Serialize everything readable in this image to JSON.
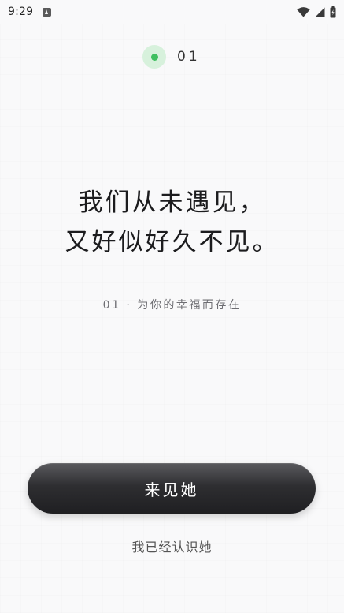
{
  "status_bar": {
    "time": "9:29",
    "icons": [
      "app-notification-icon",
      "wifi-icon",
      "cellular-signal-icon",
      "battery-icon"
    ]
  },
  "page_indicator": {
    "number": "01",
    "accent_color": "#3fbf60"
  },
  "headline": {
    "line1": "我们从未遇见，",
    "line2": "又好似好久不见。"
  },
  "subtitle": "01 · 为你的幸福而存在",
  "primary_button": {
    "label": "来见她"
  },
  "secondary_link": {
    "label": "我已经认识她"
  }
}
